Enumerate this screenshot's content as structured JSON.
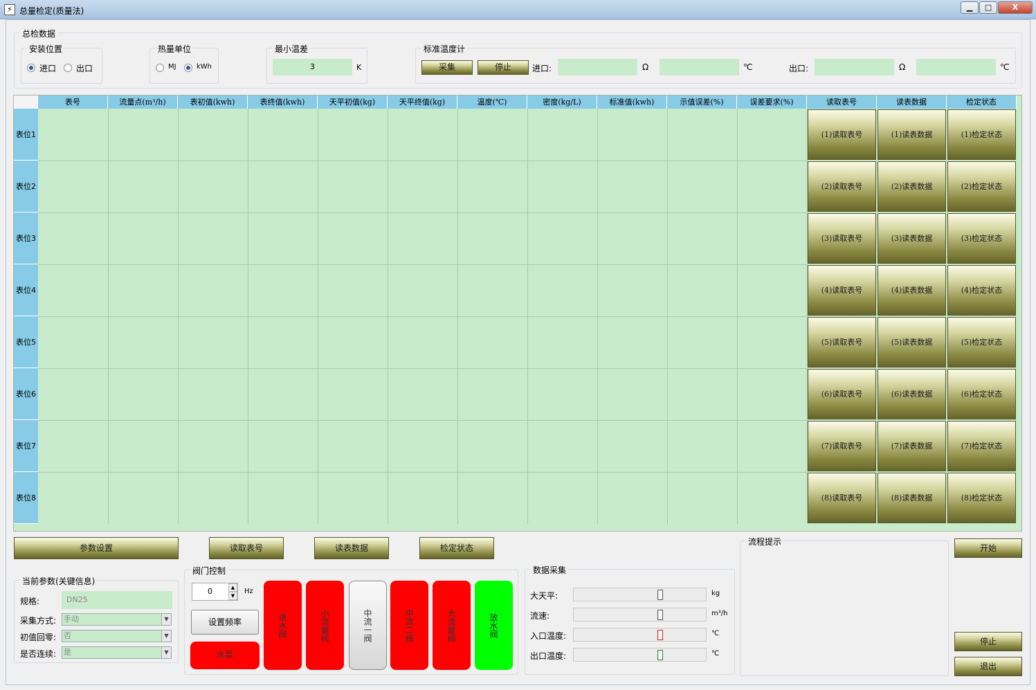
{
  "window": {
    "title": "总量检定(质量法)",
    "minimize": "▁",
    "maximize": "□",
    "close": "X"
  },
  "top": {
    "group_title": "总检数据",
    "install": {
      "title": "安装位置",
      "options": [
        "进口",
        "出口"
      ],
      "selected": "进口"
    },
    "unit": {
      "title": "热量单位",
      "options": [
        "MJ",
        "kWh"
      ],
      "selected": "kWh"
    },
    "min_temp": {
      "title": "最小温差",
      "value": "3",
      "unit": "K"
    },
    "std_therm": {
      "title": "标准温度计",
      "collect": "采集",
      "stop": "停止",
      "inlet_label": "进口:",
      "outlet_label": "出口:",
      "ohm": "Ω",
      "celsius": "℃"
    }
  },
  "table": {
    "headers": [
      "表号",
      "流量点(m³/h)",
      "表初值(kwh)",
      "表终值(kwh)",
      "天平初值(kg)",
      "天平终值(kg)",
      "温度(℃)",
      "密度(kg/L)",
      "标准值(kwh)",
      "示值误差(%)",
      "误差要求(%)",
      "读取表号",
      "读表数据",
      "检定状态"
    ],
    "rows": [
      {
        "label": "表位1",
        "b1": "(1)读取表号",
        "b2": "(1)读表数据",
        "b3": "(1)检定状态"
      },
      {
        "label": "表位2",
        "b1": "(2)读取表号",
        "b2": "(2)读表数据",
        "b3": "(2)检定状态"
      },
      {
        "label": "表位3",
        "b1": "(3)读取表号",
        "b2": "(3)读表数据",
        "b3": "(3)检定状态"
      },
      {
        "label": "表位4",
        "b1": "(4)读取表号",
        "b2": "(4)读表数据",
        "b3": "(4)检定状态"
      },
      {
        "label": "表位5",
        "b1": "(5)读取表号",
        "b2": "(5)读表数据",
        "b3": "(5)检定状态"
      },
      {
        "label": "表位6",
        "b1": "(6)读取表号",
        "b2": "(6)读表数据",
        "b3": "(6)检定状态"
      },
      {
        "label": "表位7",
        "b1": "(7)读取表号",
        "b2": "(7)读表数据",
        "b3": "(7)检定状态"
      },
      {
        "label": "表位8",
        "b1": "(8)读取表号",
        "b2": "(8)读表数据",
        "b3": "(8)检定状态"
      }
    ]
  },
  "actions": {
    "params": "参数设置",
    "read_id": "读取表号",
    "read_data": "读表数据",
    "check_state": "检定状态"
  },
  "params": {
    "title": "当前参数(关键信息)",
    "spec_label": "规格:",
    "spec_value": "DN25",
    "mode_label": "采集方式:",
    "mode_value": "手动",
    "zero_label": "初值回零:",
    "zero_value": "否",
    "cont_label": "是否连续:",
    "cont_value": "是"
  },
  "valve": {
    "title": "阀门控制",
    "freq_value": "0",
    "freq_unit": "Hz",
    "set_freq": "设置频率",
    "pump": "水泵",
    "valves": [
      {
        "name": "进水阀",
        "state": "red"
      },
      {
        "name": "小流量阀",
        "state": "red"
      },
      {
        "name": "中流一阀",
        "state": "gray"
      },
      {
        "name": "中流二阀",
        "state": "red"
      },
      {
        "name": "大流量阀",
        "state": "red"
      },
      {
        "name": "放水阀",
        "state": "green"
      }
    ],
    "colors": {
      "red": "#ff0000",
      "green": "#00ff00",
      "gray": "#e2e2e2"
    }
  },
  "acq": {
    "title": "数据采集",
    "items": [
      {
        "label": "大天平:",
        "unit": "kg"
      },
      {
        "label": "流速:",
        "unit": "m³/h"
      },
      {
        "label": "入口温度:",
        "unit": "℃"
      },
      {
        "label": "出口温度:",
        "unit": "℃"
      }
    ]
  },
  "flow": {
    "title": "流程提示"
  },
  "control": {
    "start": "开始",
    "stop": "停止",
    "exit": "退出"
  }
}
